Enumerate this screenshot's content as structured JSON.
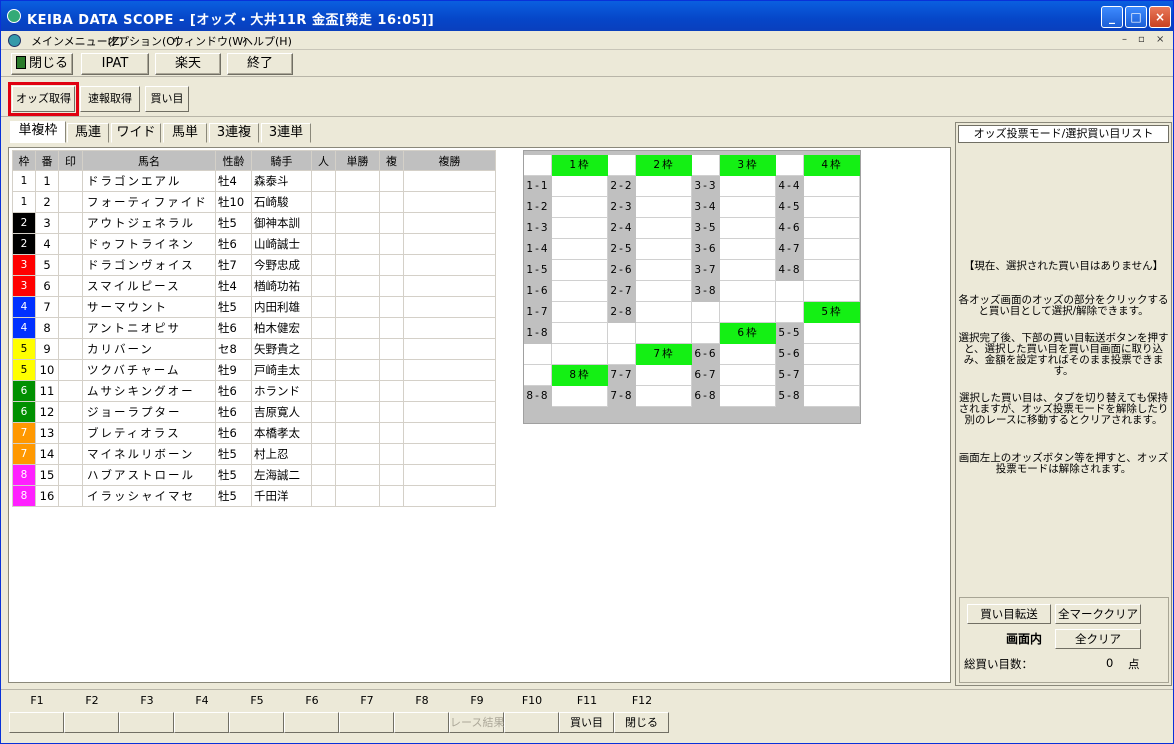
{
  "window": {
    "title": "KEIBA DATA SCOPE - [オッズ・大井11R 金盃[発走 16:05]]"
  },
  "menu": [
    "メインメニュー(Z)",
    "オプション(O)",
    "ウィンドウ(W)",
    "ヘルプ(H)"
  ],
  "toolbar": {
    "close": "閉じる",
    "ipat": "IPAT",
    "rakuten": "楽天",
    "end": "終了"
  },
  "subtoolbar": {
    "odds": "オッズ取得",
    "flash": "速報取得",
    "buy": "買い目"
  },
  "tabs": [
    "単複枠",
    "馬連",
    "ワイド",
    "馬単",
    "3連複",
    "3連単"
  ],
  "horse_table": {
    "headers": [
      "枠",
      "番",
      "印",
      "馬名",
      "性齢",
      "騎手",
      "人",
      "単勝",
      "複",
      "複勝"
    ],
    "rows": [
      [
        "1",
        "1",
        "",
        "ドラゴンエアル",
        "牡4",
        "森泰斗"
      ],
      [
        "1",
        "2",
        "",
        "フォーティファイド",
        "牡10",
        "石崎駿"
      ],
      [
        "2",
        "3",
        "",
        "アウトジェネラル",
        "牡5",
        "御神本訓"
      ],
      [
        "2",
        "4",
        "",
        "ドゥフトライネン",
        "牡6",
        "山崎誠士"
      ],
      [
        "3",
        "5",
        "",
        "ドラゴンヴォイス",
        "牡7",
        "今野忠成"
      ],
      [
        "3",
        "6",
        "",
        "スマイルピース",
        "牡4",
        "楢崎功祐"
      ],
      [
        "4",
        "7",
        "",
        "サーマウント",
        "牡5",
        "内田利雄"
      ],
      [
        "4",
        "8",
        "",
        "アントニオピサ",
        "牡6",
        "柏木健宏"
      ],
      [
        "5",
        "9",
        "",
        "カリバーン",
        "セ8",
        "矢野貴之"
      ],
      [
        "5",
        "10",
        "",
        "ツクバチャーム",
        "牡9",
        "戸崎圭太"
      ],
      [
        "6",
        "11",
        "",
        "ムサシキングオー",
        "牡6",
        "ホランド"
      ],
      [
        "6",
        "12",
        "",
        "ジョーラプター",
        "牡6",
        "吉原寛人"
      ],
      [
        "7",
        "13",
        "",
        "ブレティオラス",
        "牡6",
        "本橋孝太"
      ],
      [
        "7",
        "14",
        "",
        "マイネルリボーン",
        "牡5",
        "村上忍"
      ],
      [
        "8",
        "15",
        "",
        "ハブアストロール",
        "牡5",
        "左海誠二"
      ],
      [
        "8",
        "16",
        "",
        "イラッシャイマセ",
        "牡5",
        "千田洋"
      ]
    ]
  },
  "waku_colors": {
    "1": "#ffffff",
    "2": "#000000",
    "3": "#ff0000",
    "4": "#0030ff",
    "5": "#ffff00",
    "6": "#009000",
    "7": "#ff9800",
    "8": "#ff20ff"
  },
  "waku_text_colors": {
    "1": "#000000",
    "2": "#ffffff",
    "3": "#ffffff",
    "4": "#ffffff",
    "5": "#000000",
    "6": "#ffffff",
    "7": "#ffffff",
    "8": "#ffffff"
  },
  "waku_grid": {
    "rows": [
      [
        "",
        "1枠",
        "",
        "2枠",
        "",
        "3枠",
        "",
        "4枠"
      ],
      [
        "1-1",
        "",
        "2-2",
        "",
        "3-3",
        "",
        "4-4",
        ""
      ],
      [
        "1-2",
        "",
        "2-3",
        "",
        "3-4",
        "",
        "4-5",
        ""
      ],
      [
        "1-3",
        "",
        "2-4",
        "",
        "3-5",
        "",
        "4-6",
        ""
      ],
      [
        "1-4",
        "",
        "2-5",
        "",
        "3-6",
        "",
        "4-7",
        ""
      ],
      [
        "1-5",
        "",
        "2-6",
        "",
        "3-7",
        "",
        "4-8",
        ""
      ],
      [
        "1-6",
        "",
        "2-7",
        "",
        "3-8",
        "",
        "",
        ""
      ],
      [
        "1-7",
        "",
        "2-8",
        "",
        "",
        "",
        "",
        "5枠"
      ],
      [
        "1-8",
        "",
        "",
        "",
        "",
        "6枠",
        "5-5",
        ""
      ],
      [
        "",
        "",
        "",
        "7枠",
        "6-6",
        "",
        "5-6",
        ""
      ],
      [
        "",
        "8枠",
        "7-7",
        "",
        "6-7",
        "",
        "5-7",
        ""
      ],
      [
        "8-8",
        "",
        "7-8",
        "",
        "6-8",
        "",
        "5-8",
        ""
      ]
    ],
    "kinds": [
      [
        "w",
        "g",
        "w",
        "g",
        "w",
        "g",
        "w",
        "g"
      ],
      [
        "l",
        "w",
        "l",
        "w",
        "l",
        "w",
        "l",
        "w"
      ],
      [
        "l",
        "w",
        "l",
        "w",
        "l",
        "w",
        "l",
        "w"
      ],
      [
        "l",
        "w",
        "l",
        "w",
        "l",
        "w",
        "l",
        "w"
      ],
      [
        "l",
        "w",
        "l",
        "w",
        "l",
        "w",
        "l",
        "w"
      ],
      [
        "l",
        "w",
        "l",
        "w",
        "l",
        "w",
        "l",
        "w"
      ],
      [
        "l",
        "w",
        "l",
        "w",
        "l",
        "w",
        "w",
        "w"
      ],
      [
        "l",
        "w",
        "l",
        "w",
        "w",
        "w",
        "w",
        "g"
      ],
      [
        "l",
        "w",
        "w",
        "w",
        "w",
        "g",
        "l",
        "w"
      ],
      [
        "w",
        "w",
        "w",
        "g",
        "l",
        "w",
        "l",
        "w"
      ],
      [
        "w",
        "g",
        "l",
        "w",
        "l",
        "w",
        "l",
        "w"
      ],
      [
        "l",
        "w",
        "l",
        "w",
        "l",
        "w",
        "l",
        "w"
      ]
    ]
  },
  "right_panel": {
    "title": "オッズ投票モード/選択買い目リスト",
    "status": "【現在、選択された買い目はありません】",
    "info1": "各オッズ画面のオッズの部分をクリックすると買い目として選択/解除できます。",
    "info2": "選択完了後、下部の買い目転送ボタンを押すと、選択した買い目を買い目画面に取り込み、金額を設定すればそのまま投票できます。",
    "info3": "選択した買い目は、タブを切り替えても保持されますが、オッズ投票モードを解除したり別のレースに移動するとクリアされます。",
    "info4": "画面左上のオッズボタン等を押すと、オッズ投票モードは解除されます。",
    "transfer": "買い目転送",
    "clear_marks": "全マーククリア",
    "in_screen": "画面内",
    "clear_all": "全クリア",
    "total_label": "総買い目数：",
    "total_value": "0",
    "total_unit": "点"
  },
  "fkeys": [
    "F1",
    "F2",
    "F3",
    "F4",
    "F5",
    "F6",
    "F7",
    "F8",
    "F9",
    "F10",
    "F11",
    "F12"
  ],
  "fbuttons": [
    "",
    "",
    "",
    "",
    "",
    "",
    "",
    "",
    "レース結果",
    "",
    "買い目",
    "閉じる"
  ]
}
